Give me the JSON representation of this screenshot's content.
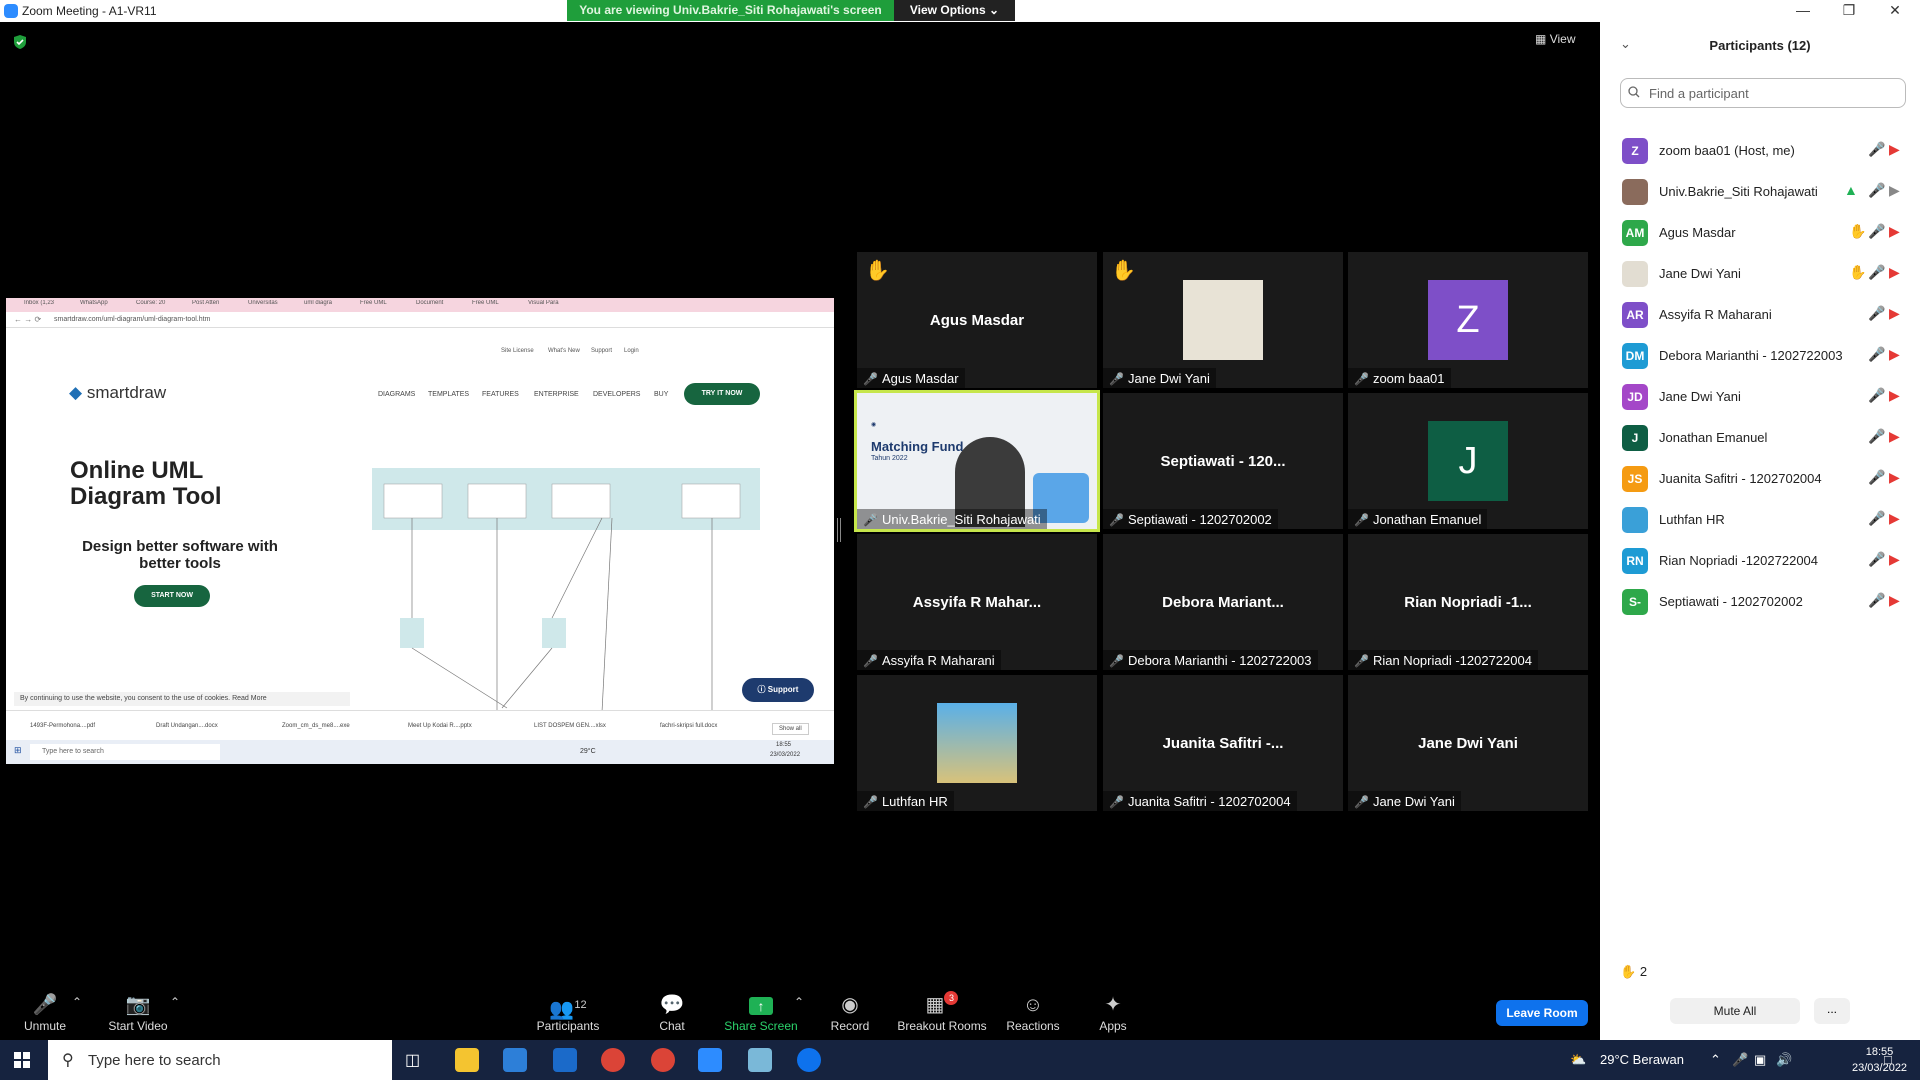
{
  "window": {
    "title": "Zoom Meeting - A1-VR11"
  },
  "banner": {
    "text": "You are viewing Univ.Bakrie_Siti Rohajawati's screen",
    "view_options": "View Options"
  },
  "view_button": "View",
  "shared": {
    "tabs": [
      "Inbox (1,23",
      "WhatsApp",
      "Course: 20",
      "Post Atten",
      "Universitas",
      "uml diagra",
      "Free UML",
      "Document",
      "Free UML",
      "Visual Para"
    ],
    "url": "smartdraw.com/uml-diagram/uml-diagram-tool.htm",
    "top_nav": [
      "Site License",
      "What's New",
      "Support",
      "Login"
    ],
    "logo": "smartdraw",
    "main_nav": [
      "DIAGRAMS",
      "TEMPLATES",
      "FEATURES",
      "ENTERPRISE",
      "DEVELOPERS",
      "BUY"
    ],
    "try_button": "TRY IT NOW",
    "hero": [
      "Online UML",
      "Diagram Tool"
    ],
    "sub": "Design better software with better tools",
    "start_button": "START NOW",
    "cookie": "By continuing to use the website, you consent to the use of cookies.   Read More",
    "support": "Support",
    "downloads": [
      "1493F-Permohona....pdf",
      "Draft Undangan....docx",
      "Zoom_cm_ds_me8....exe",
      "Meet Up Kodai R....pptx",
      "LIST DOSPEM GEN....xlsx",
      "fachri-skripsi full.docx"
    ],
    "show_all": "Show all",
    "taskbar_search": "Type here to search",
    "taskbar_temp": "29°C",
    "taskbar_time": "18:55",
    "taskbar_date": "23/03/2022"
  },
  "tiles": [
    {
      "name": "Agus Masdar",
      "label": "Agus Masdar",
      "hand": true
    },
    {
      "name": "",
      "label": "Jane Dwi Yani",
      "hand": true
    },
    {
      "name": "",
      "label": "zoom baa01",
      "hand": false,
      "initial": "Z",
      "color": "#7e4fc8"
    },
    {
      "name": "",
      "label": "Univ.Bakrie_Siti Rohajawati",
      "hand": false
    },
    {
      "name": "Septiawati - 120...",
      "label": "Septiawati - 1202702002",
      "hand": false
    },
    {
      "name": "",
      "label": "Jonathan Emanuel",
      "hand": false,
      "initial": "J",
      "color": "#0e5e44"
    },
    {
      "name": "Assyifa R Mahar...",
      "label": "Assyifa R Maharani",
      "hand": false
    },
    {
      "name": "Debora Mariant...",
      "label": "Debora Marianthi - 1202722003",
      "hand": false
    },
    {
      "name": "Rian Nopriadi -1...",
      "label": "Rian Nopriadi -1202722004",
      "hand": false
    },
    {
      "name": "",
      "label": "Luthfan HR",
      "hand": false
    },
    {
      "name": "Juanita Safitri -...",
      "label": "Juanita Safitri - 1202702004",
      "hand": false
    },
    {
      "name": "Jane Dwi Yani",
      "label": "Jane Dwi Yani",
      "hand": false
    }
  ],
  "presenter_slide": {
    "title": "Matching Fund",
    "year": "Tahun 2022"
  },
  "panel": {
    "title": "Participants (12)",
    "search_placeholder": "Find a participant",
    "participants": [
      {
        "initials": "Z",
        "name": "zoom baa01 (Host, me)",
        "color": "#7e4fc8",
        "hand": false
      },
      {
        "initials": "",
        "name": "Univ.Bakrie_Siti Rohajawati",
        "color": "#8a6b5c",
        "hand": false,
        "sharing": true
      },
      {
        "initials": "AM",
        "name": "Agus Masdar",
        "color": "#2ea84a",
        "hand": true
      },
      {
        "initials": "",
        "name": "Jane Dwi Yani",
        "color": "#e2ddd2",
        "hand": true
      },
      {
        "initials": "AR",
        "name": "Assyifa R Maharani",
        "color": "#7e4fc8",
        "hand": false
      },
      {
        "initials": "DM",
        "name": "Debora Marianthi - 1202722003",
        "color": "#1e9bd4",
        "hand": false
      },
      {
        "initials": "JD",
        "name": "Jane Dwi Yani",
        "color": "#a447c8",
        "hand": false
      },
      {
        "initials": "J",
        "name": "Jonathan Emanuel",
        "color": "#0e5e44",
        "hand": false
      },
      {
        "initials": "JS",
        "name": "Juanita Safitri - 1202702004",
        "color": "#f59b12",
        "hand": false
      },
      {
        "initials": "",
        "name": "Luthfan HR",
        "color": "#3aa0d8",
        "hand": false
      },
      {
        "initials": "RN",
        "name": "Rian Nopriadi -1202722004",
        "color": "#1e9bd4",
        "hand": false
      },
      {
        "initials": "S-",
        "name": "Septiawati - 1202702002",
        "color": "#2ea84a",
        "hand": false
      }
    ],
    "hand_count": "2",
    "mute_all": "Mute All",
    "more": "..."
  },
  "toolbar": {
    "unmute": "Unmute",
    "start_video": "Start Video",
    "participants": "Participants",
    "participants_count": "12",
    "chat": "Chat",
    "share_screen": "Share Screen",
    "record": "Record",
    "breakout": "Breakout Rooms",
    "breakout_badge": "3",
    "reactions": "Reactions",
    "apps": "Apps",
    "leave": "Leave Room"
  },
  "taskbar": {
    "search": "Type here to search",
    "weather": "29°C  Berawan",
    "time": "18:55",
    "date": "23/03/2022"
  },
  "colors": {
    "accent": "#0e72ed",
    "share_green": "#1f9e3b",
    "muted_red": "#e53935",
    "hand_yellow": "#f7b500"
  }
}
